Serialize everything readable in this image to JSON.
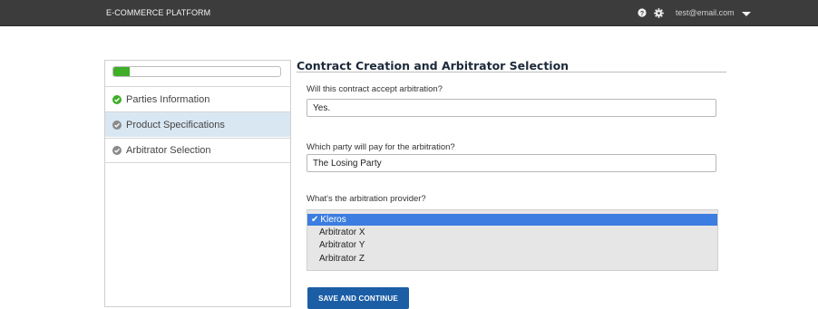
{
  "header": {
    "brand": "E-COMMERCE PLATFORM",
    "help_icon": "help-circle-icon",
    "settings_icon": "gear-icon",
    "user_email": "test@email.com",
    "menu_icon": "caret-down-icon"
  },
  "sidebar": {
    "progress": 0.1,
    "progress_color": "#3fae29",
    "steps": [
      {
        "label": "Parties Information",
        "status": "complete",
        "icon": "check-circle-icon",
        "icon_color": "#3fae29"
      },
      {
        "label": "Product Specifications",
        "status": "current",
        "icon": "check-circle-icon",
        "icon_color": "#8a8a8a"
      },
      {
        "label": "Arbitrator Selection",
        "status": "pending",
        "icon": "check-circle-icon",
        "icon_color": "#8a8a8a"
      }
    ]
  },
  "main": {
    "title": "Contract Creation and Arbitrator Selection",
    "questions": [
      {
        "label": "Will this contract accept arbitration?",
        "value": "Yes."
      },
      {
        "label": "Which party will pay for the arbitration?",
        "value": "The Losing Party"
      }
    ],
    "provider": {
      "label": "What's the arbitration provider?",
      "options": [
        "Kleros",
        "Arbitrator X",
        "Arbitrator Y",
        "Arbitrator Z"
      ],
      "selected": "Kleros",
      "selected_prefix": "✔"
    },
    "save_label": "SAVE AND CONTINUE"
  },
  "colors": {
    "topbar": "#3c3c3c",
    "active_step": "#d9e7f2",
    "selection": "#3b7de0",
    "primary_button": "#1b5ea6"
  }
}
